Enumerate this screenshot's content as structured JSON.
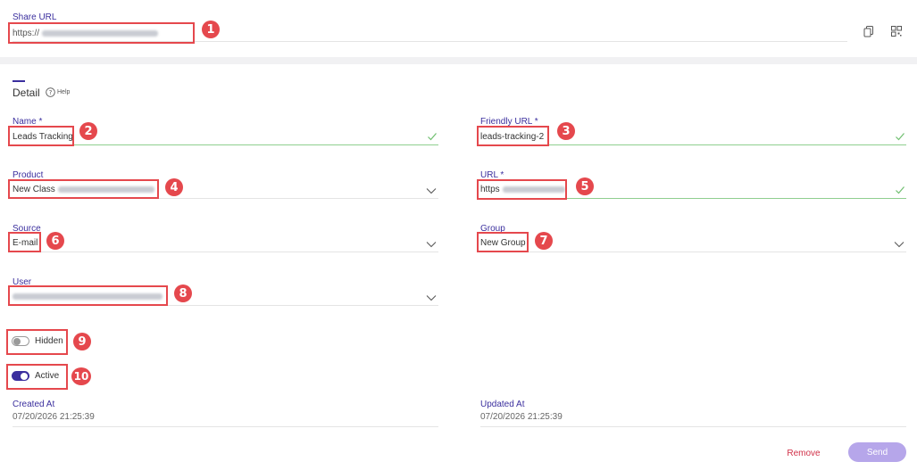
{
  "share": {
    "label": "Share URL",
    "value_prefix": "https://"
  },
  "detail": {
    "tab_label": "Detail",
    "help_label": "Help"
  },
  "fields": {
    "name": {
      "label": "Name *",
      "value": "Leads Tracking"
    },
    "friendly_url": {
      "label": "Friendly URL *",
      "value": "leads-tracking-2"
    },
    "product": {
      "label": "Product",
      "value_prefix": "New Class"
    },
    "url": {
      "label": "URL *",
      "value_prefix": "https"
    },
    "source": {
      "label": "Source",
      "value": "E-mail"
    },
    "group": {
      "label": "Group",
      "value": "New Group"
    },
    "user": {
      "label": "User"
    }
  },
  "toggles": {
    "hidden": {
      "label": "Hidden",
      "on": false
    },
    "active": {
      "label": "Active",
      "on": true
    }
  },
  "meta": {
    "created_label": "Created At",
    "created_value": "07/20/2026 21:25:39",
    "updated_label": "Updated At",
    "updated_value": "07/20/2026 21:25:39"
  },
  "actions": {
    "remove_label": "Remove",
    "send_label": "Send"
  },
  "annotations": [
    "1",
    "2",
    "3",
    "4",
    "5",
    "6",
    "7",
    "8",
    "9",
    "10"
  ],
  "colors": {
    "accent": "#3b2f9e",
    "annotation": "#e5484d",
    "valid": "#8fcf8f",
    "send_bg": "#b6a6ea",
    "remove": "#d03048"
  },
  "icons": {
    "copy": "copy-icon",
    "qr": "qr-code-icon",
    "help": "help-circle-icon",
    "check": "check-icon",
    "chevron": "chevron-down-icon"
  }
}
